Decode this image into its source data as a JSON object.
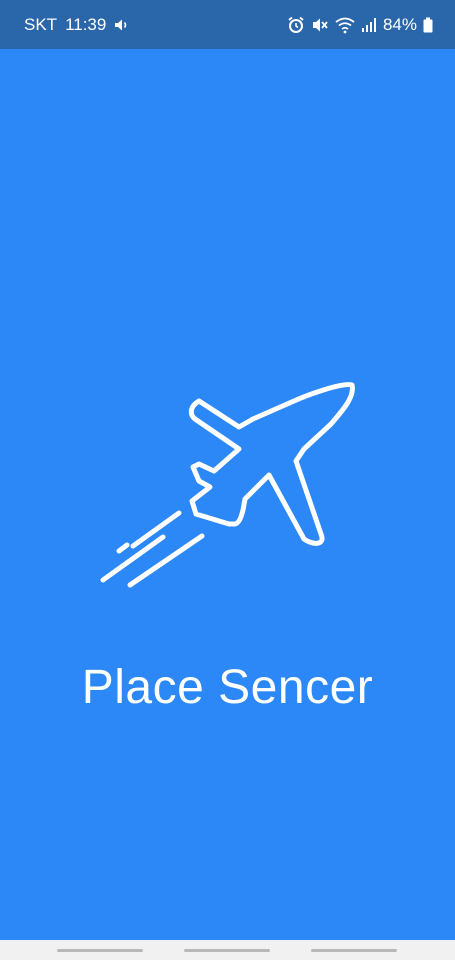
{
  "status_bar": {
    "carrier": "SKT",
    "time": "11:39",
    "battery": "84%",
    "icons": [
      "volume-icon",
      "alarm-icon",
      "mute-icon",
      "wifi-icon",
      "signal-icon",
      "battery-icon"
    ]
  },
  "splash": {
    "app_name": "Place Sencer",
    "logo_icon": "airplane-takeoff-icon",
    "background_color": "#2b88f6",
    "logo_color": "#ffffff"
  },
  "nav_bar": {
    "buttons": [
      "recent-apps-button",
      "home-button",
      "back-button"
    ]
  }
}
